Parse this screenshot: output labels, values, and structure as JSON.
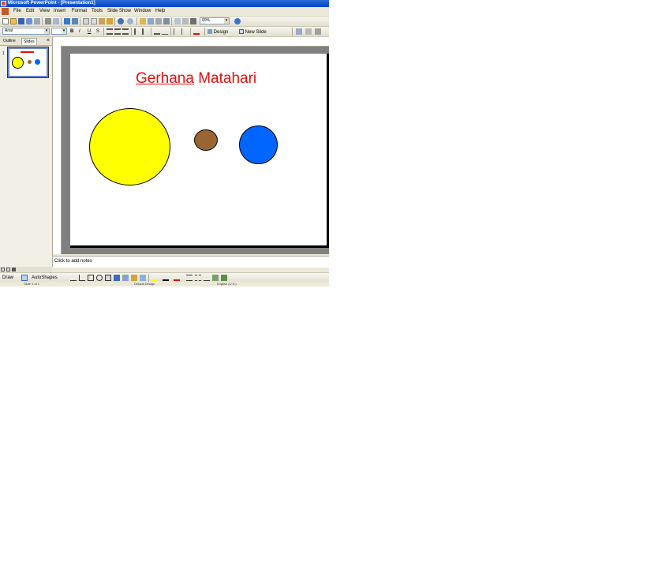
{
  "window": {
    "title": "Microsoft PowerPoint - [Presentation1]"
  },
  "menubar": {
    "items": [
      "File",
      "Edit",
      "View",
      "Insert",
      "Format",
      "Tools",
      "Slide Show",
      "Window",
      "Help"
    ]
  },
  "toolbar": {
    "zoom_value": "60%",
    "font_name": "Arial",
    "bold_label": "B",
    "italic_label": "I",
    "underline_label": "U",
    "shadow_label": "S",
    "design_label": "Design",
    "new_slide_label": "New Slide"
  },
  "left_pane": {
    "tabs": [
      "Outline",
      "Slides"
    ],
    "close_glyph": "×",
    "slide_number": "1"
  },
  "slide": {
    "title_underlined": "Gerhana",
    "title_rest": " Matahari",
    "shapes": [
      {
        "name": "sun",
        "color": "#ffff00"
      },
      {
        "name": "moon",
        "color": "#996633"
      },
      {
        "name": "earth",
        "color": "#0066ff"
      }
    ]
  },
  "notes": {
    "placeholder": "Click to add notes"
  },
  "drawing_toolbar": {
    "draw_label": "Draw",
    "autoshapes_label": "AutoShapes"
  },
  "statusbar": {
    "slide_info": "Slide 1 of 1",
    "design": "Default Design",
    "language": "English (U.S.)"
  },
  "colors": {
    "title_red": "#e11010",
    "titlebar_blue": "#0a46c6"
  }
}
